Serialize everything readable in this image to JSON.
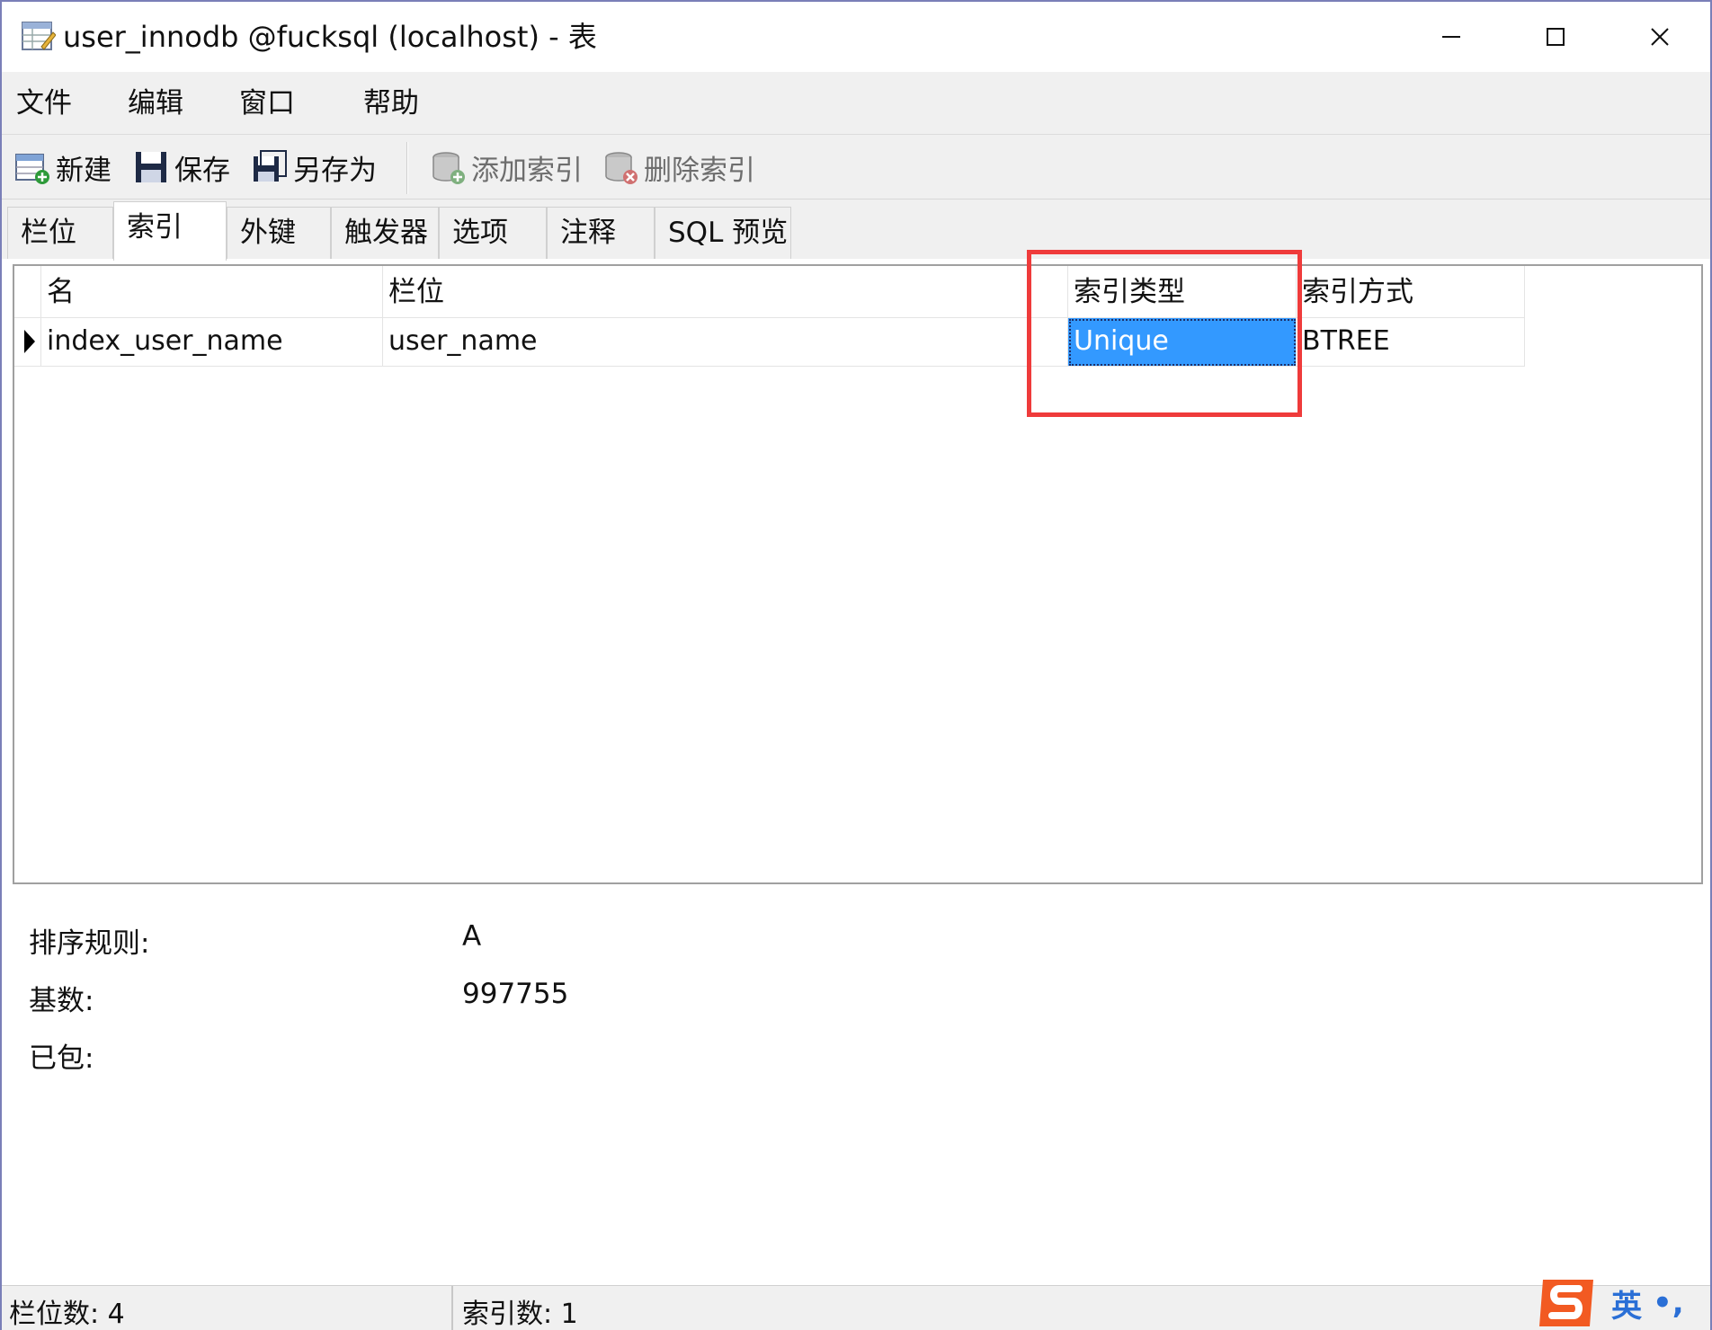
{
  "window": {
    "title": "user_innodb @fucksql (localhost) - 表"
  },
  "menu": [
    "文件",
    "编辑",
    "窗口",
    "帮助"
  ],
  "toolbar": {
    "new_label": "新建",
    "save_label": "保存",
    "saveas_label": "另存为",
    "add_index_label": "添加索引",
    "delete_index_label": "删除索引"
  },
  "tabs": [
    "栏位",
    "索引",
    "外键",
    "触发器",
    "选项",
    "注释",
    "SQL 预览"
  ],
  "active_tab": "索引",
  "grid": {
    "headers": [
      "名",
      "栏位",
      "索引类型",
      "索引方式"
    ],
    "rows": [
      {
        "name": "index_user_name",
        "column": "user_name",
        "type": "Unique",
        "method": "BTREE"
      }
    ]
  },
  "details": [
    {
      "label": "排序规则:",
      "value": "A"
    },
    {
      "label": "基数:",
      "value": "997755"
    },
    {
      "label": "已包:",
      "value": ""
    }
  ],
  "status": {
    "column_count": "栏位数: 4",
    "index_count": "索引数: 1"
  },
  "ime": {
    "text": "英",
    "punct": "•,"
  },
  "colors": {
    "selection": "#3399ff",
    "highlight_box": "#ef3b3b",
    "chrome": "#f0f0f0"
  }
}
